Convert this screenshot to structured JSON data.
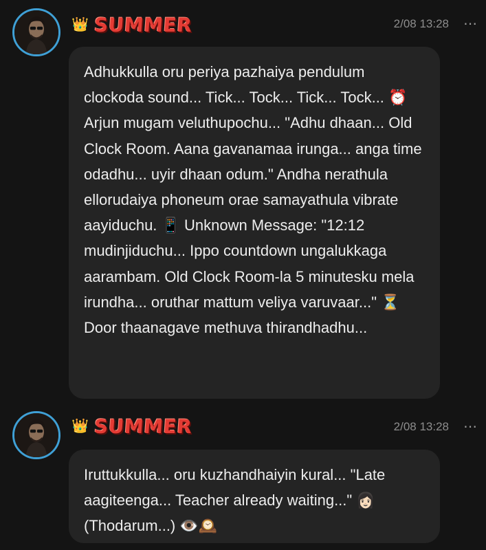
{
  "messages": [
    {
      "crown": "👑",
      "author": "SUMMER",
      "timestamp": "2/08 13:28",
      "more_icon": "⋯",
      "text": "Adhukkulla oru periya pazhaiya pendulum clockoda sound... Tick... Tock... Tick... Tock... ⏰ Arjun mugam veluthupochu... \"Adhu dhaan... Old Clock Room. Aana gavanamaa irunga... anga time odadhu... uyir dhaan odum.\" Andha nerathula ellorudaiya phoneum orae samayathula vibrate aayiduchu. 📱 Unknown Message: \"12:12 mudinjiduchu... Ippo countdown ungalukkaga aarambam. Old Clock Room-la 5 minutesku mela irundha... oruthar mattum veliya varuvaar...\" ⏳ Door thaanagave methuva thirandhadhu..."
    },
    {
      "crown": "👑",
      "author": "SUMMER",
      "timestamp": "2/08 13:28",
      "more_icon": "⋯",
      "text": "Iruttukkulla... oru kuzhandhaiyin kural... \"Late aagiteenga... Teacher already waiting...\" 👩🏻\n(Thodarum...) 👁️🕰️"
    }
  ]
}
